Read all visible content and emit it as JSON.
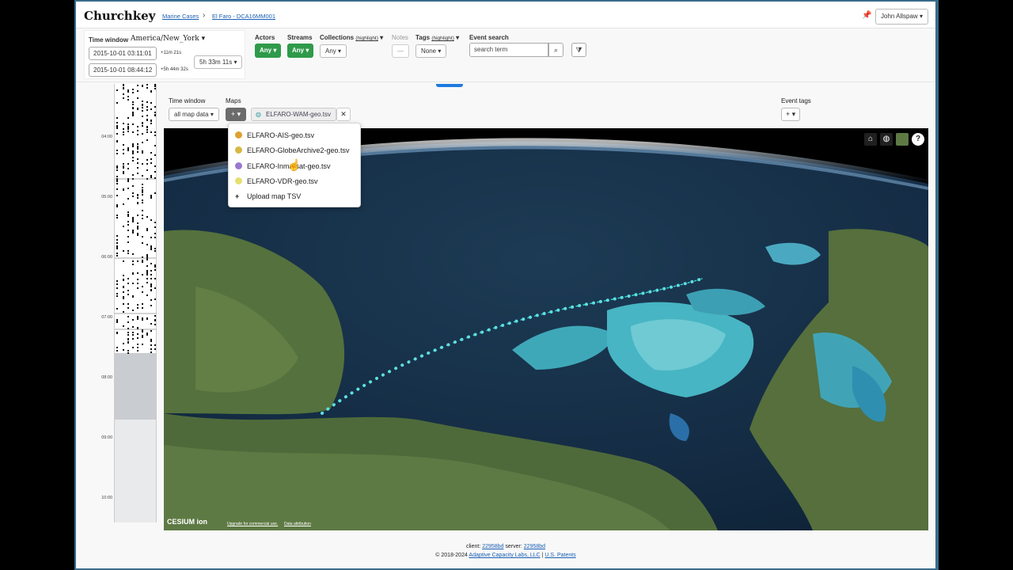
{
  "header": {
    "brand": "Churchkey",
    "breadcrumb": [
      "Marine Cases",
      "El Faro - DCA16MM001"
    ],
    "user": "John Allspaw"
  },
  "time_window": {
    "label": "Time window",
    "timezone": "America/New_York",
    "start": "2015-10-01 03:11:01",
    "start_delta": "+11m 21s",
    "end": "2015-10-01 08:44:12",
    "end_delta": "+5h 44m 32s",
    "duration": "5h 33m 11s"
  },
  "filters": {
    "actors_label": "Actors",
    "actors_value": "Any",
    "streams_label": "Streams",
    "streams_value": "Any",
    "collections_label": "Collections",
    "highlight": "(highlight)",
    "collections_value": "Any",
    "notes_label": "Notes",
    "notes_value": "—",
    "tags_label": "Tags",
    "tags_value": "None",
    "event_search_label": "Event search",
    "search_placeholder": "search term"
  },
  "timeline": {
    "ticks": [
      "04:00",
      "05:00",
      "06:00",
      "07:00",
      "08:00",
      "09:00",
      "10:00"
    ]
  },
  "maps": {
    "time_window_label": "Time window",
    "time_window_value": "all map data",
    "maps_label": "Maps",
    "add_label": "+",
    "active_map": "ELFARO-WAM-geo.tsv",
    "event_tags_label": "Event tags",
    "event_tags_add": "+",
    "menu": [
      {
        "label": "ELFARO-AIS-geo.tsv",
        "color": "#e0a030"
      },
      {
        "label": "ELFARO-GlobeArchive2-geo.tsv",
        "color": "#d7b840"
      },
      {
        "label": "ELFARO-Inmarsat-geo.tsv",
        "color": "#9a78d0"
      },
      {
        "label": "ELFARO-VDR-geo.tsv",
        "color": "#e6e070"
      }
    ],
    "upload_label": "Upload map TSV",
    "cesium_logo": "CESIUM ion",
    "credit_commercial": "Upgrade for commercial use.",
    "credit_data": "Data attribution"
  },
  "footer": {
    "client_label": "client:",
    "client_hash": "22958bd",
    "server_label": "server:",
    "server_hash": "22958bd",
    "copyright": "© 2018-2024",
    "company": "Adaptive Capacity Labs, LLC",
    "patents": "U.S. Patents"
  }
}
